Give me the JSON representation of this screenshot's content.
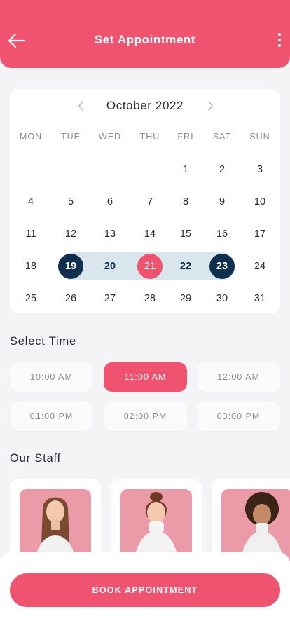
{
  "header": {
    "title": "Set Appointment"
  },
  "calendar": {
    "month_label": "October 2022",
    "weekdays": [
      "MON",
      "TUE",
      "WED",
      "THU",
      "FRI",
      "SAT",
      "SUN"
    ],
    "rows": [
      [
        "",
        "",
        "",
        "",
        "1",
        "2",
        "3"
      ],
      [
        "4",
        "5",
        "6",
        "7",
        "8",
        "9",
        "10"
      ],
      [
        "11",
        "12",
        "13",
        "14",
        "15",
        "16",
        "17"
      ],
      [
        "18",
        "19",
        "20",
        "21",
        "22",
        "23",
        "24"
      ],
      [
        "25",
        "26",
        "27",
        "28",
        "29",
        "30",
        "31"
      ]
    ],
    "range_start": "19",
    "range_end": "23",
    "today": "21"
  },
  "time": {
    "title": "Select Time",
    "slots": [
      "10:00 AM",
      "11:00 AM",
      "12:00 AM",
      "01:00 PM",
      "02:00 PM",
      "03:00 PM"
    ],
    "selected": "11:00 AM"
  },
  "staff": {
    "title": "Our Staff"
  },
  "book_button": {
    "label": "BOOK APPOINTMENT"
  },
  "colors": {
    "accent": "#f0536f",
    "navy": "#0e2f4d",
    "range": "#d9e6ee"
  }
}
